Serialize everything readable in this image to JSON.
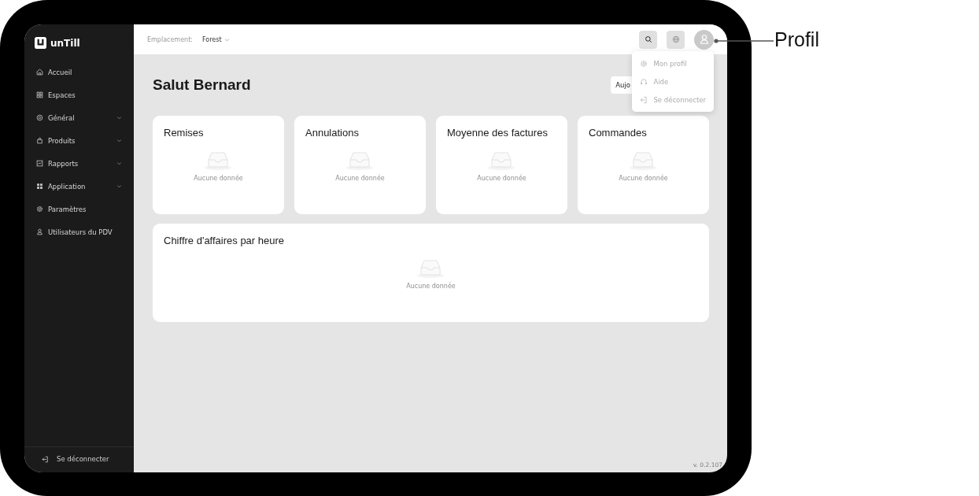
{
  "sidebar": {
    "logo": "unTill",
    "items": [
      {
        "label": "Accueil",
        "expandable": false
      },
      {
        "label": "Espaces",
        "expandable": false
      },
      {
        "label": "Général",
        "expandable": true
      },
      {
        "label": "Produits",
        "expandable": true
      },
      {
        "label": "Rapports",
        "expandable": true
      },
      {
        "label": "Application",
        "expandable": true
      },
      {
        "label": "Paramètres",
        "expandable": false
      },
      {
        "label": "Utilisateurs du PDV",
        "expandable": false
      }
    ],
    "logout": "Se déconnecter"
  },
  "topbar": {
    "location_label": "Emplacement:",
    "location_value": "Forest"
  },
  "profile_menu": {
    "items": [
      "Mon profil",
      "Aide",
      "Se déconnecter"
    ]
  },
  "greeting": "Salut Bernard",
  "period_button": "Aujo",
  "cards": [
    {
      "title": "Remises",
      "empty": "Aucune donnée"
    },
    {
      "title": "Annulations",
      "empty": "Aucune donnée"
    },
    {
      "title": "Moyenne des factures",
      "empty": "Aucune donnée"
    },
    {
      "title": "Commandes",
      "empty": "Aucune donnée"
    }
  ],
  "hourly_card": {
    "title": "Chiffre d'affaires par heure",
    "empty": "Aucune donnée"
  },
  "version": "v. 0.2.107",
  "annotation": "Profil"
}
